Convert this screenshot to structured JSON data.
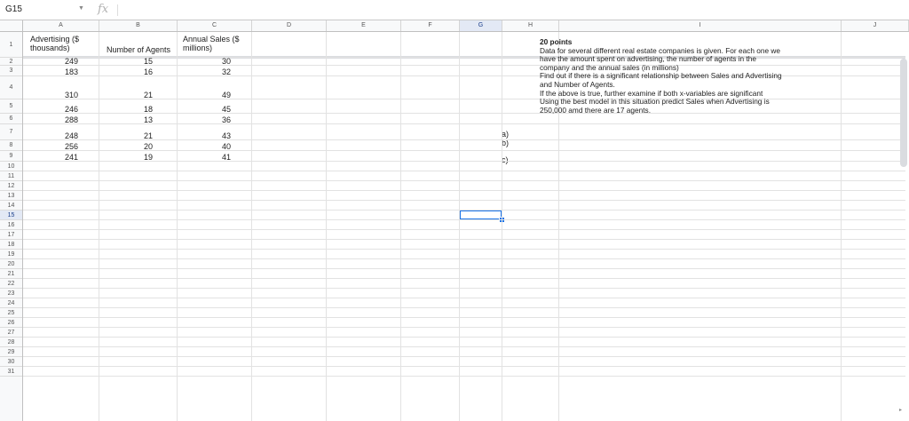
{
  "formula_bar": {
    "cell_ref": "G15",
    "fx": "fx",
    "value": ""
  },
  "columns": [
    "A",
    "B",
    "C",
    "D",
    "E",
    "F",
    "G",
    "H",
    "I",
    "J"
  ],
  "rows": [
    "1",
    "2",
    "3",
    "4",
    "5",
    "6",
    "7",
    "8",
    "9",
    "10",
    "11",
    "12",
    "13",
    "14",
    "15",
    "16",
    "17",
    "18",
    "19",
    "20",
    "21",
    "22",
    "23",
    "24",
    "25",
    "26",
    "27",
    "28",
    "29",
    "30",
    "31"
  ],
  "headers": {
    "a": [
      "Advertising ($",
      "thousands)"
    ],
    "b": "Number of Agents",
    "c": [
      "Annual Sales ($",
      "millions)"
    ]
  },
  "data_rows": [
    {
      "a": "249",
      "b": "15",
      "c": "30"
    },
    {
      "a": "183",
      "b": "16",
      "c": "32"
    },
    {
      "a": "310",
      "b": "21",
      "c": "49"
    },
    {
      "a": "246",
      "b": "18",
      "c": "45"
    },
    {
      "a": "288",
      "b": "13",
      "c": "36"
    },
    {
      "a": "248",
      "b": "21",
      "c": "43"
    },
    {
      "a": "256",
      "b": "20",
      "c": "40"
    },
    {
      "a": "241",
      "b": "19",
      "c": "41"
    }
  ],
  "labels": {
    "a": "a)",
    "b": "b)",
    "c": "c)"
  },
  "note": {
    "title": "20 points",
    "lines": [
      "Data for several different real estate companies is given. For each one we",
      "have the amount spent on advertising, the number of agents in the",
      "company and the annual sales (in millions)",
      "Find out if there is a significant relationship between Sales and Advertising",
      "and Number of Agents.",
      "If the above is true, further examine if both x-variables are significant",
      "Using the best model in this situation predict Sales when Advertising is",
      "250,000 amd there are 17 agents."
    ]
  },
  "selection": {
    "column": "G",
    "row": "15"
  }
}
